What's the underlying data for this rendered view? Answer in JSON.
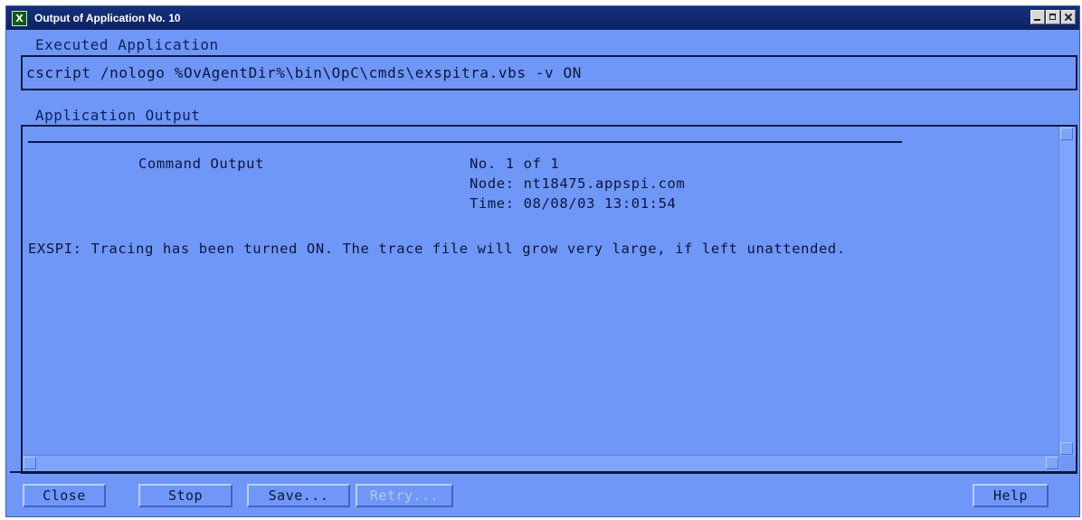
{
  "window": {
    "title": "Output of Application No. 10",
    "icon_letter": "X",
    "controls": [
      "minimize-icon",
      "maximize-icon",
      "close-icon"
    ]
  },
  "executed": {
    "label": "Executed Application",
    "command": "cscript /nologo %OvAgentDir%\\bin\\OpC\\cmds\\exspitra.vbs -v ON"
  },
  "output": {
    "label": "Application Output",
    "header_title": "Command Output",
    "counter": "No. 1 of 1",
    "node": "Node: nt18475.appspi.com",
    "time": "Time: 08/08/03 13:01:54",
    "message": "EXSPI: Tracing has been turned ON. The trace file will grow very large, if left unattended."
  },
  "buttons": {
    "close": "Close",
    "stop": "Stop",
    "save": "Save...",
    "retry": "Retry...",
    "help": "Help"
  },
  "colors": {
    "background": "#6f97f7",
    "titlebar": "#0c2266",
    "text": "#0c1638"
  }
}
